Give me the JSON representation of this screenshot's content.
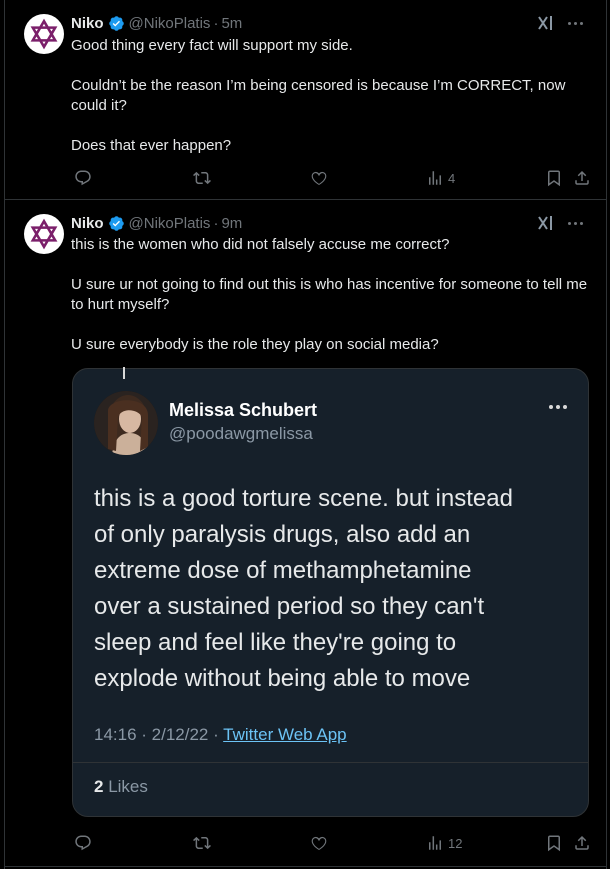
{
  "colors": {
    "background": "#000000",
    "accent": "#1d9bf0",
    "muted": "#71767b",
    "card": "#16202a",
    "link": "#6cc3f5"
  },
  "tweets": [
    {
      "name": "Niko",
      "handle": "@NikoPlatis",
      "time": "5m",
      "paragraphs": [
        "Good thing every fact will support my side.",
        "Couldn’t be the reason I’m being censored is because I’m CORRECT, now could it?",
        "Does that ever happen?"
      ],
      "views": "4"
    },
    {
      "name": "Niko",
      "handle": "@NikoPlatis",
      "time": "9m",
      "paragraphs": [
        "this is the women who did not falsely accuse me correct?",
        "U sure ur not going to find out this is who has incentive for someone to tell me to hurt myself?",
        "U sure everybody is the role they play on social media?"
      ],
      "views": "12",
      "embedded": {
        "name": "Melissa Schubert",
        "handle": "@poodawgmelissa",
        "body_lines": [
          "this is a good torture scene. but instead",
          "of only paralysis drugs, also add an",
          "extreme dose of methamphetamine",
          "over a sustained period so they can't",
          "sleep and feel like they're going to",
          "explode without being able to move"
        ],
        "timestamp": "14:16 · 2/12/22 · ",
        "source": "Twitter Web App",
        "likes_count": "2",
        "likes_label": " Likes"
      }
    }
  ],
  "icons": {
    "avatar": "star-of-david-icon",
    "verified": "verified-badge-icon",
    "grok": "grok-icon",
    "more": "more-icon",
    "reply": "reply-icon",
    "retweet": "retweet-icon",
    "like": "heart-icon",
    "views": "views-icon",
    "bookmark": "bookmark-icon",
    "share": "share-icon"
  },
  "dot": "·"
}
